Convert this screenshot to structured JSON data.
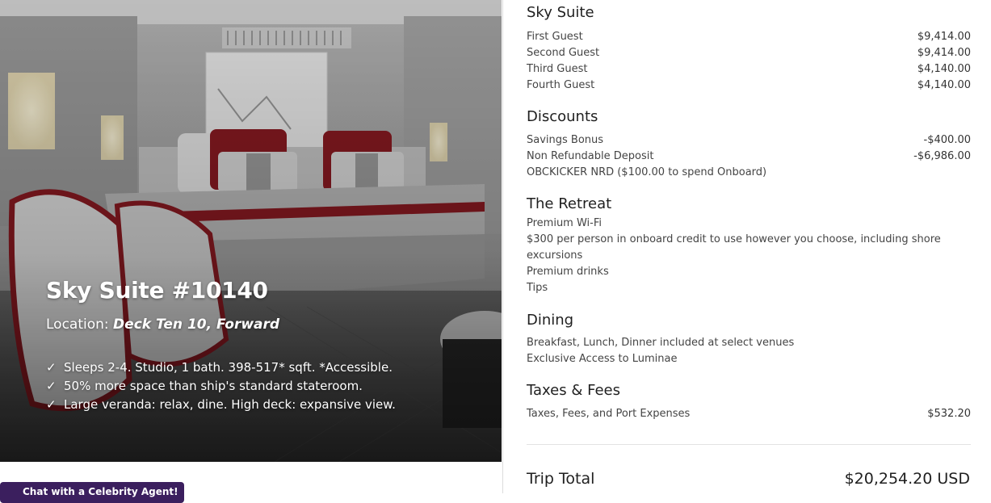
{
  "hero": {
    "title": "Sky Suite #10140",
    "location_label": "Location:",
    "location_value": "Deck Ten 10, Forward",
    "features": [
      "Sleeps 2-4. Studio, 1 bath. 398-517* sqft. *Accessible.",
      "50% more space than ship's standard stateroom.",
      "Large veranda: relax, dine. High deck: expansive view."
    ],
    "check_glyph": "✓"
  },
  "chat": {
    "label": "Chat with a Celebrity Agent!"
  },
  "summary": {
    "suite": {
      "title": "Sky Suite",
      "guests": [
        {
          "label": "First Guest",
          "amount": "$9,414.00"
        },
        {
          "label": "Second Guest",
          "amount": "$9,414.00"
        },
        {
          "label": "Third Guest",
          "amount": "$4,140.00"
        },
        {
          "label": "Fourth Guest",
          "amount": "$4,140.00"
        }
      ]
    },
    "discounts": {
      "title": "Discounts",
      "items": [
        {
          "label": "Savings Bonus",
          "amount": "-$400.00"
        },
        {
          "label": "Non Refundable Deposit",
          "amount": "-$6,986.00"
        }
      ],
      "note": "OBCKICKER NRD ($100.00 to spend Onboard)"
    },
    "retreat": {
      "title": "The Retreat",
      "perks": [
        "Premium Wi-Fi",
        "$300 per person in onboard credit to use however you choose, including shore excursions",
        "Premium drinks",
        "Tips"
      ]
    },
    "dining": {
      "title": "Dining",
      "items": [
        "Breakfast, Lunch, Dinner included at select venues",
        "Exclusive Access to Luminae"
      ]
    },
    "taxes": {
      "title": "Taxes & Fees",
      "label": "Taxes, Fees, and Port Expenses",
      "amount": "$532.20"
    },
    "total": {
      "label": "Trip Total",
      "amount": "$20,254.20 USD"
    }
  },
  "colors": {
    "chat_bg": "#3b1f5e",
    "accent_red": "#8b1a22",
    "text_dark": "#1f1f1f"
  }
}
